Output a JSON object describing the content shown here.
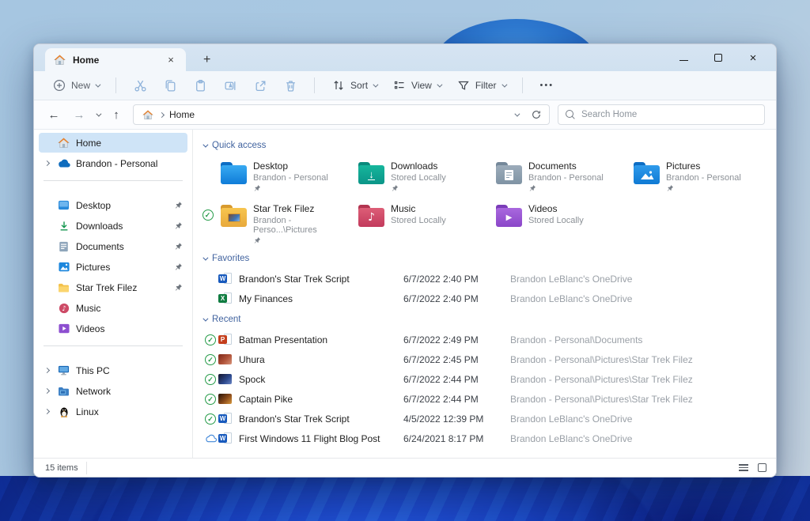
{
  "window": {
    "tab_title": "Home",
    "tab_close_glyph": "×",
    "new_tab_glyph": "+",
    "close_glyph": "×"
  },
  "toolbar": {
    "new_label": "New",
    "sort_label": "Sort",
    "view_label": "View",
    "filter_label": "Filter",
    "more_label": "•••",
    "icons": [
      "plus-circle",
      "cut",
      "copy",
      "paste",
      "rename",
      "share",
      "delete",
      "sort-arrows",
      "view-list",
      "filter-funnel",
      "more-dots"
    ]
  },
  "addressbar": {
    "breadcrumb_root": "Home",
    "search_placeholder": "Search Home"
  },
  "sidebar": {
    "items": [
      {
        "label": "Home"
      },
      {
        "label": "Brandon - Personal"
      },
      {
        "label": "Desktop"
      },
      {
        "label": "Downloads"
      },
      {
        "label": "Documents"
      },
      {
        "label": "Pictures"
      },
      {
        "label": "Star Trek Filez"
      },
      {
        "label": "Music"
      },
      {
        "label": "Videos"
      },
      {
        "label": "This PC"
      },
      {
        "label": "Network"
      },
      {
        "label": "Linux"
      }
    ]
  },
  "sections": {
    "quick_access": "Quick access",
    "favorites": "Favorites",
    "recent": "Recent"
  },
  "tiles": [
    {
      "name": "Desktop",
      "subtitle": "Brandon - Personal"
    },
    {
      "name": "Downloads",
      "subtitle": "Stored Locally"
    },
    {
      "name": "Documents",
      "subtitle": "Brandon - Personal"
    },
    {
      "name": "Pictures",
      "subtitle": "Brandon - Personal"
    },
    {
      "name": "Star Trek Filez",
      "subtitle": "Brandon - Perso...\\Pictures"
    },
    {
      "name": "Music",
      "subtitle": "Stored Locally"
    },
    {
      "name": "Videos",
      "subtitle": "Stored Locally"
    }
  ],
  "favorites": [
    {
      "name": "Brandon's Star Trek Script",
      "date": "6/7/2022 2:40 PM",
      "location": "Brandon LeBlanc's OneDrive"
    },
    {
      "name": "My Finances",
      "date": "6/7/2022 2:40 PM",
      "location": "Brandon LeBlanc's OneDrive"
    }
  ],
  "recent": [
    {
      "name": "Batman Presentation",
      "date": "6/7/2022 2:49 PM",
      "location": "Brandon - Personal\\Documents"
    },
    {
      "name": "Uhura",
      "date": "6/7/2022 2:45 PM",
      "location": "Brandon - Personal\\Pictures\\Star Trek Filez"
    },
    {
      "name": "Spock",
      "date": "6/7/2022 2:44 PM",
      "location": "Brandon - Personal\\Pictures\\Star Trek Filez"
    },
    {
      "name": "Captain Pike",
      "date": "6/7/2022 2:44 PM",
      "location": "Brandon - Personal\\Pictures\\Star Trek Filez"
    },
    {
      "name": "Brandon's Star Trek Script",
      "date": "4/5/2022 12:39 PM",
      "location": "Brandon LeBlanc's OneDrive"
    },
    {
      "name": "First Windows 11 Flight Blog Post",
      "date": "6/24/2021 8:17 PM",
      "location": "Brandon LeBlanc's OneDrive"
    }
  ],
  "statusbar": {
    "items_count": "15 items"
  },
  "colors": {
    "accent": "#0067c0",
    "section_header": "#41639f",
    "sync_green": "#259b48",
    "onedrive_blue": "#0f6cbd",
    "titlebar": "#d3e3f1"
  }
}
